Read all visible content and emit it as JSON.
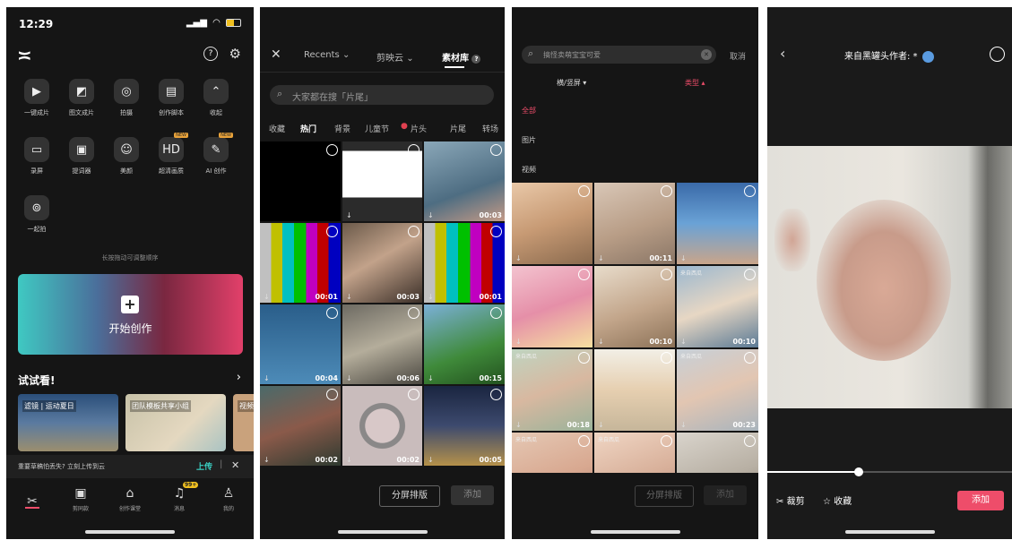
{
  "screen1": {
    "time": "12:29",
    "tools": [
      {
        "label": "一键成片",
        "icon": "play-square-icon",
        "glyph": "▶"
      },
      {
        "label": "图文成片",
        "icon": "image-text-icon",
        "glyph": "◩"
      },
      {
        "label": "拍摄",
        "icon": "camera-icon",
        "glyph": "◎"
      },
      {
        "label": "创作脚本",
        "icon": "script-icon",
        "glyph": "▤"
      },
      {
        "label": "收起",
        "icon": "chevron-up-icon",
        "glyph": "⌃"
      },
      {
        "label": "录屏",
        "icon": "screen-record-icon",
        "glyph": "▭"
      },
      {
        "label": "提词器",
        "icon": "teleprompter-icon",
        "glyph": "▣"
      },
      {
        "label": "美颜",
        "icon": "beauty-icon",
        "glyph": "☺"
      },
      {
        "label": "超清画质",
        "icon": "hd-icon",
        "glyph": "HD",
        "badge": "NEW"
      },
      {
        "label": "AI 创作",
        "icon": "ai-create-icon",
        "glyph": "✎",
        "badge": "NEW"
      },
      {
        "label": "一起拍",
        "icon": "together-icon",
        "glyph": "⊚"
      }
    ],
    "hint": "长按拖动可调整顺序",
    "start_label": "开始创作",
    "try_title": "试试看!",
    "try_cards": [
      "滤镜 | 运动夏日",
      "团队模板共享小组",
      "视频"
    ],
    "draft_notice": "重要草稿怕丢失? 立刻上传到云",
    "upload_label": "上传",
    "nav": [
      {
        "label": "",
        "icon": "scissors-icon",
        "glyph": "✂"
      },
      {
        "label": "剪同款",
        "icon": "template-icon",
        "glyph": "▣"
      },
      {
        "label": "创作课堂",
        "icon": "class-icon",
        "glyph": "⌂"
      },
      {
        "label": "消息",
        "icon": "bell-icon",
        "glyph": "♫",
        "badge": "99+"
      },
      {
        "label": "我的",
        "icon": "profile-icon",
        "glyph": "♙"
      }
    ]
  },
  "screen2": {
    "tabs": [
      "Recents",
      "剪映云",
      "素材库"
    ],
    "search_placeholder": "大家都在搜「片尾」",
    "categories": [
      "收藏",
      "热门",
      "背景",
      "儿童节",
      "片头",
      "片尾",
      "转场"
    ],
    "durations": [
      "",
      "",
      "00:03",
      "00:01",
      "00:03",
      "00:01",
      "00:04",
      "00:06",
      "00:15",
      "00:02",
      "00:02",
      "00:05"
    ],
    "split_label": "分屏排版",
    "add_label": "添加"
  },
  "screen3": {
    "search_placeholder": "搞怪卖萌宝宝可爱",
    "cancel_label": "取消",
    "filter_orientation": "横/竖屏",
    "filter_type": "类型",
    "type_options": [
      "全部",
      "图片",
      "视频"
    ],
    "durations": [
      "",
      "00:11",
      "",
      "",
      "00:10",
      "00:10",
      "00:18",
      "",
      "00:23",
      "",
      "",
      ""
    ],
    "source_label": "来自西瓜",
    "split_label": "分屏排版",
    "add_label": "添加"
  },
  "screen4": {
    "title": "来自黑罐头作者: *",
    "crop_label": "裁剪",
    "favorite_label": "收藏",
    "add_label": "添加",
    "accent": "#ee4d6a"
  }
}
